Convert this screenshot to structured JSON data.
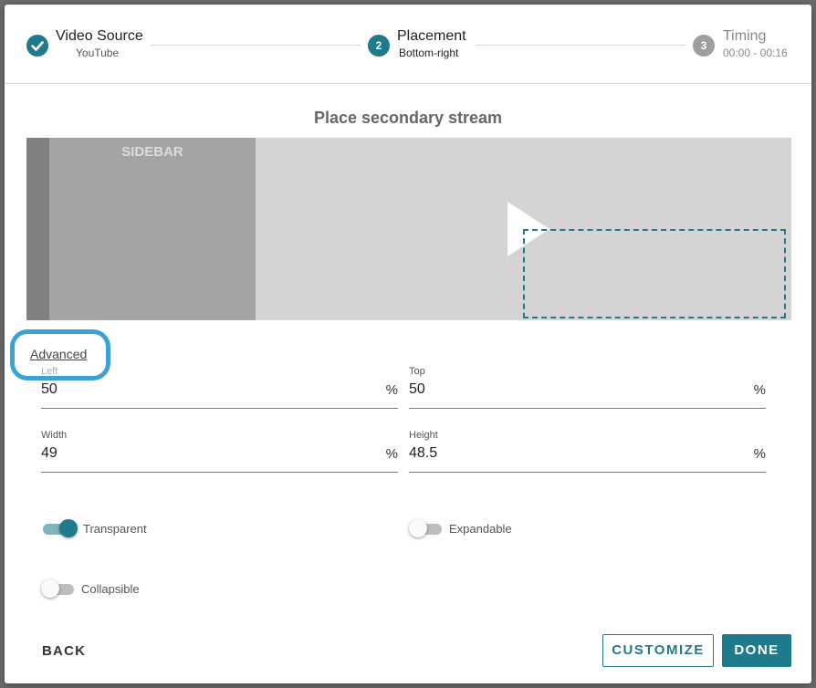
{
  "stepper": {
    "steps": [
      {
        "title": "Video Source",
        "subtitle": "YouTube",
        "state": "done",
        "icon": "check-icon"
      },
      {
        "title": "Placement",
        "subtitle": "Bottom-right",
        "state": "active",
        "number": "2"
      },
      {
        "title": "Timing",
        "subtitle": "00:00 - 00:16",
        "state": "pending",
        "number": "3"
      }
    ]
  },
  "preview": {
    "title": "Place secondary stream",
    "sidebar_label": "SIDEBAR",
    "play_icon": "play-icon"
  },
  "advanced": {
    "label": "Advanced"
  },
  "fields": {
    "left": {
      "label": "Left",
      "value": "50",
      "unit": "%"
    },
    "top": {
      "label": "Top",
      "value": "50",
      "unit": "%"
    },
    "width": {
      "label": "Width",
      "value": "49",
      "unit": "%"
    },
    "height": {
      "label": "Height",
      "value": "48.5",
      "unit": "%"
    }
  },
  "toggles": {
    "transparent": {
      "label": "Transparent",
      "on": true
    },
    "expandable": {
      "label": "Expandable",
      "on": false
    },
    "collapsible": {
      "label": "Collapsible",
      "on": false
    }
  },
  "actions": {
    "back": "BACK",
    "customize": "CUSTOMIZE",
    "done": "DONE"
  },
  "colors": {
    "accent": "#1f7a8c",
    "pending": "#9e9e9e",
    "focus_ring": "#3aa3d6"
  }
}
